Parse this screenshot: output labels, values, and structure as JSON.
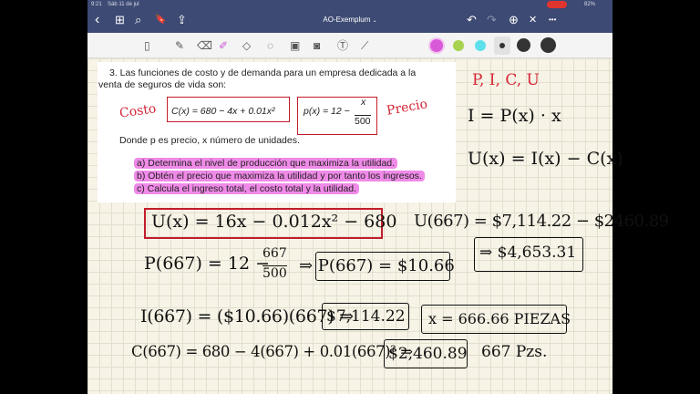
{
  "status": {
    "time": "9:21",
    "date": "Sáb 11 de jul",
    "battery": "82%"
  },
  "nav": {
    "title": "AO-Exemplum",
    "back": "‹",
    "grid": "⊞",
    "search": "⌕",
    "bookmark": "🔖",
    "share": "⇪",
    "undo": "↶",
    "redo": "↷",
    "add_page": "⊕",
    "close": "✕",
    "more": "•••"
  },
  "toolbar": {
    "tools": [
      "reading-mode",
      "pen",
      "eraser",
      "highlighter",
      "shapes",
      "lasso",
      "image",
      "camera",
      "text",
      "laser"
    ],
    "colors": [
      "#d95ad8",
      "#a8d24f",
      "#5ee0ea"
    ],
    "sizes": [
      "small",
      "medium",
      "large"
    ]
  },
  "problem": {
    "intro1": "3.  Las funciones de costo y de demanda para un empresa dedicada a la",
    "intro2": "venta de seguros de vida son:",
    "cost": "C(x) = 680 − 4x + 0.01x²",
    "price_lhs": "p(x) = 12 −",
    "price_num": "x",
    "price_den": "500",
    "donde": "Donde p es precio, x número de unidades.",
    "a": "a)  Determina el nivel de producción que maximiza la utilidad.",
    "b": "b)  Obtén el precio que maximiza la utilidad y por tanto los ingresos.",
    "c": "c)  Calcula el ingreso total, el costo total y la utilidad."
  },
  "notes": {
    "costo": "Costo",
    "precio": "Precio",
    "picu": "P,  I,  C,  U",
    "ingreso": "I = P(x) · x",
    "utilidad": "U(x) = I(x) − C(x)",
    "u_func": "U(x) = 16x − 0.012x² − 680",
    "u667": "U(667) = $7,114.22 − $2460.89",
    "u667_result": "⇒ $4,653.31",
    "p667_lhs": "P(667) = 12 −",
    "p667_num": "667",
    "p667_den": "500",
    "p667_result": "⇒ P(667) = $10.66",
    "i667": "I(667) = ($10.66)(667) ⇒",
    "i667_result": "$7,114.22",
    "x_result": "x = 666.66 PIEZAS",
    "c667": "C(667) = 680 − 4(667) + 0.01(667)² ⇒",
    "c667_result": "$2,460.89",
    "pzs": "667  Pzs."
  }
}
